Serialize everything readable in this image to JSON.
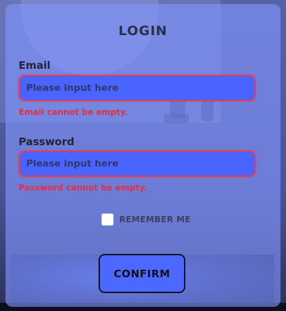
{
  "form": {
    "title": "LOGIN",
    "email": {
      "label": "Email",
      "placeholder": "Please input here",
      "value": "",
      "error": "Email cannot be empty."
    },
    "password": {
      "label": "Password",
      "placeholder": "Please input here",
      "value": "",
      "error": "Password cannot be empty."
    },
    "remember_me": {
      "label": "REMEMBER ME",
      "checked": false
    },
    "confirm_label": "CONFIRM"
  },
  "colors": {
    "card": "#8296ff",
    "input_fill": "#4a65ff",
    "error": "#e03048",
    "border_error": "#e03c56",
    "text_dark": "#232435"
  },
  "icons": {
    "checkbox": "checkbox-unchecked-icon"
  }
}
